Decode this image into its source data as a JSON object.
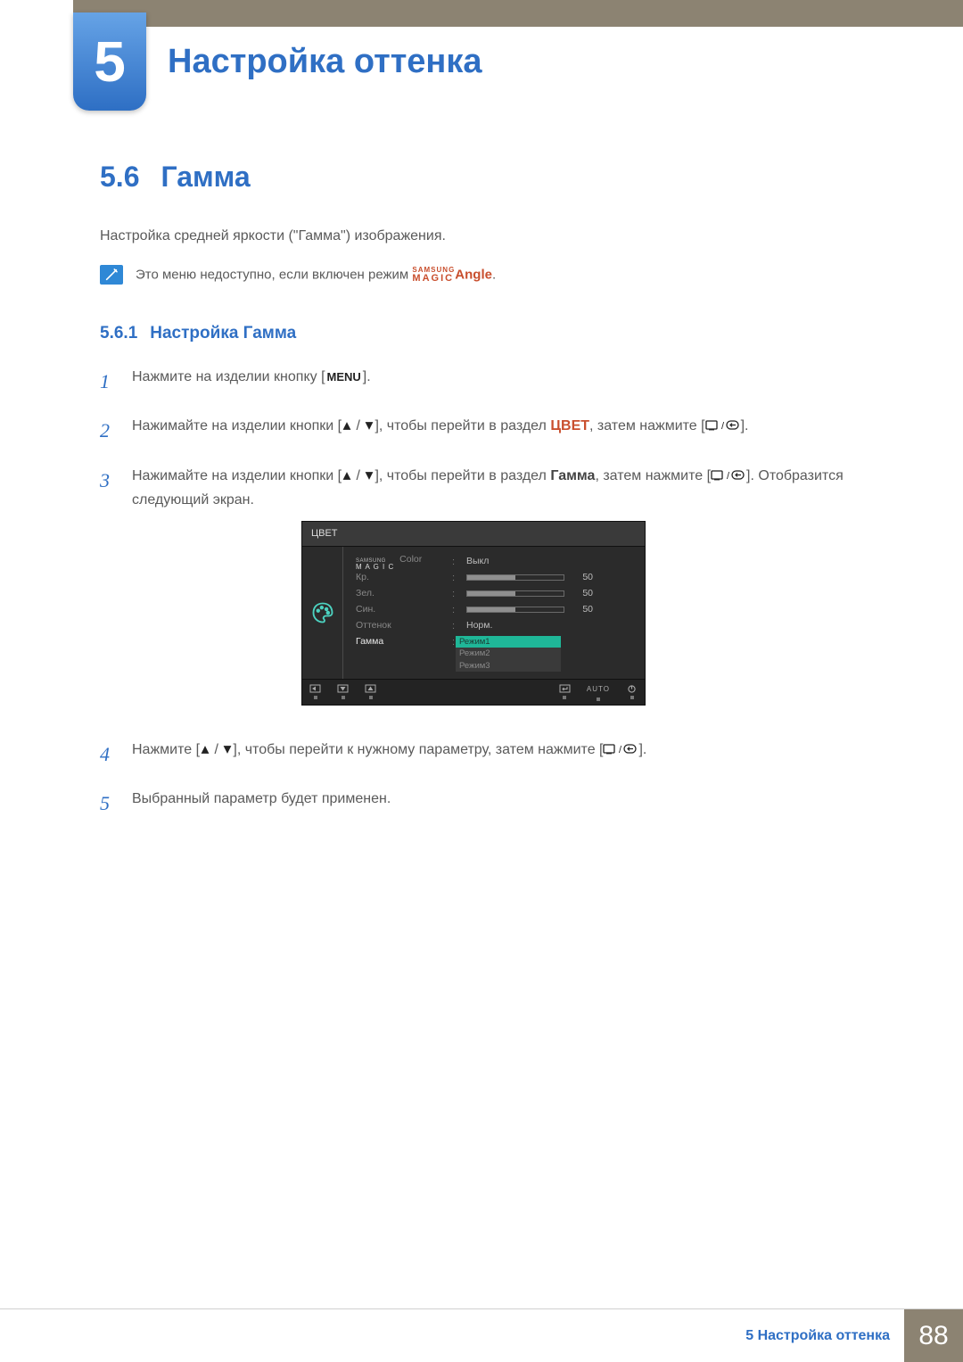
{
  "chapter": {
    "number": "5",
    "title": "Настройка оттенка"
  },
  "section": {
    "number": "5.6",
    "title": "Гамма"
  },
  "intro": "Настройка средней яркости (\"Гамма\") изображения.",
  "note": {
    "prefix": "Это меню недоступно, если включен режим ",
    "brand_top": "SAMSUNG",
    "brand_bottom": "MAGIC",
    "brand_suffix": "Angle",
    "suffix": "."
  },
  "subsection": {
    "number": "5.6.1",
    "title": "Настройка Гамма"
  },
  "steps": {
    "n1": "1",
    "s1a": "Нажмите на изделии кнопку [",
    "s1_menu": "MENU",
    "s1b": "].",
    "n2": "2",
    "s2a": "Нажимайте на изделии кнопки [",
    "s2b": "], чтобы перейти в раздел ",
    "s2_kw": "ЦВЕТ",
    "s2c": ", затем нажмите [",
    "s2d": "].",
    "n3": "3",
    "s3a": "Нажимайте на изделии кнопки [",
    "s3b": "], чтобы перейти в раздел ",
    "s3_kw": "Гамма",
    "s3c": ", затем нажмите [",
    "s3d": "]. Отобразится следующий экран.",
    "n4": "4",
    "s4a": "Нажмите [",
    "s4b": "], чтобы перейти к нужному параметру, затем нажмите [",
    "s4c": "].",
    "n5": "5",
    "s5": "Выбранный параметр будет применен."
  },
  "osd": {
    "title": "ЦВЕТ",
    "magic_top": "SAMSUNG",
    "magic_bottom": "M A G I C",
    "magic_color": "Color",
    "magic_val": "Выкл",
    "red": {
      "label": "Кр.",
      "value": "50",
      "pct": 50
    },
    "green": {
      "label": "Зел.",
      "value": "50",
      "pct": 50
    },
    "blue": {
      "label": "Син.",
      "value": "50",
      "pct": 50
    },
    "tone": {
      "label": "Оттенок",
      "value": "Норм."
    },
    "gamma": {
      "label": "Гамма",
      "opt1": "Режим1",
      "opt2": "Режим2",
      "opt3": "Режим3"
    },
    "footer_auto": "AUTO"
  },
  "footer": {
    "label": "5 Настройка оттенка",
    "page": "88"
  }
}
